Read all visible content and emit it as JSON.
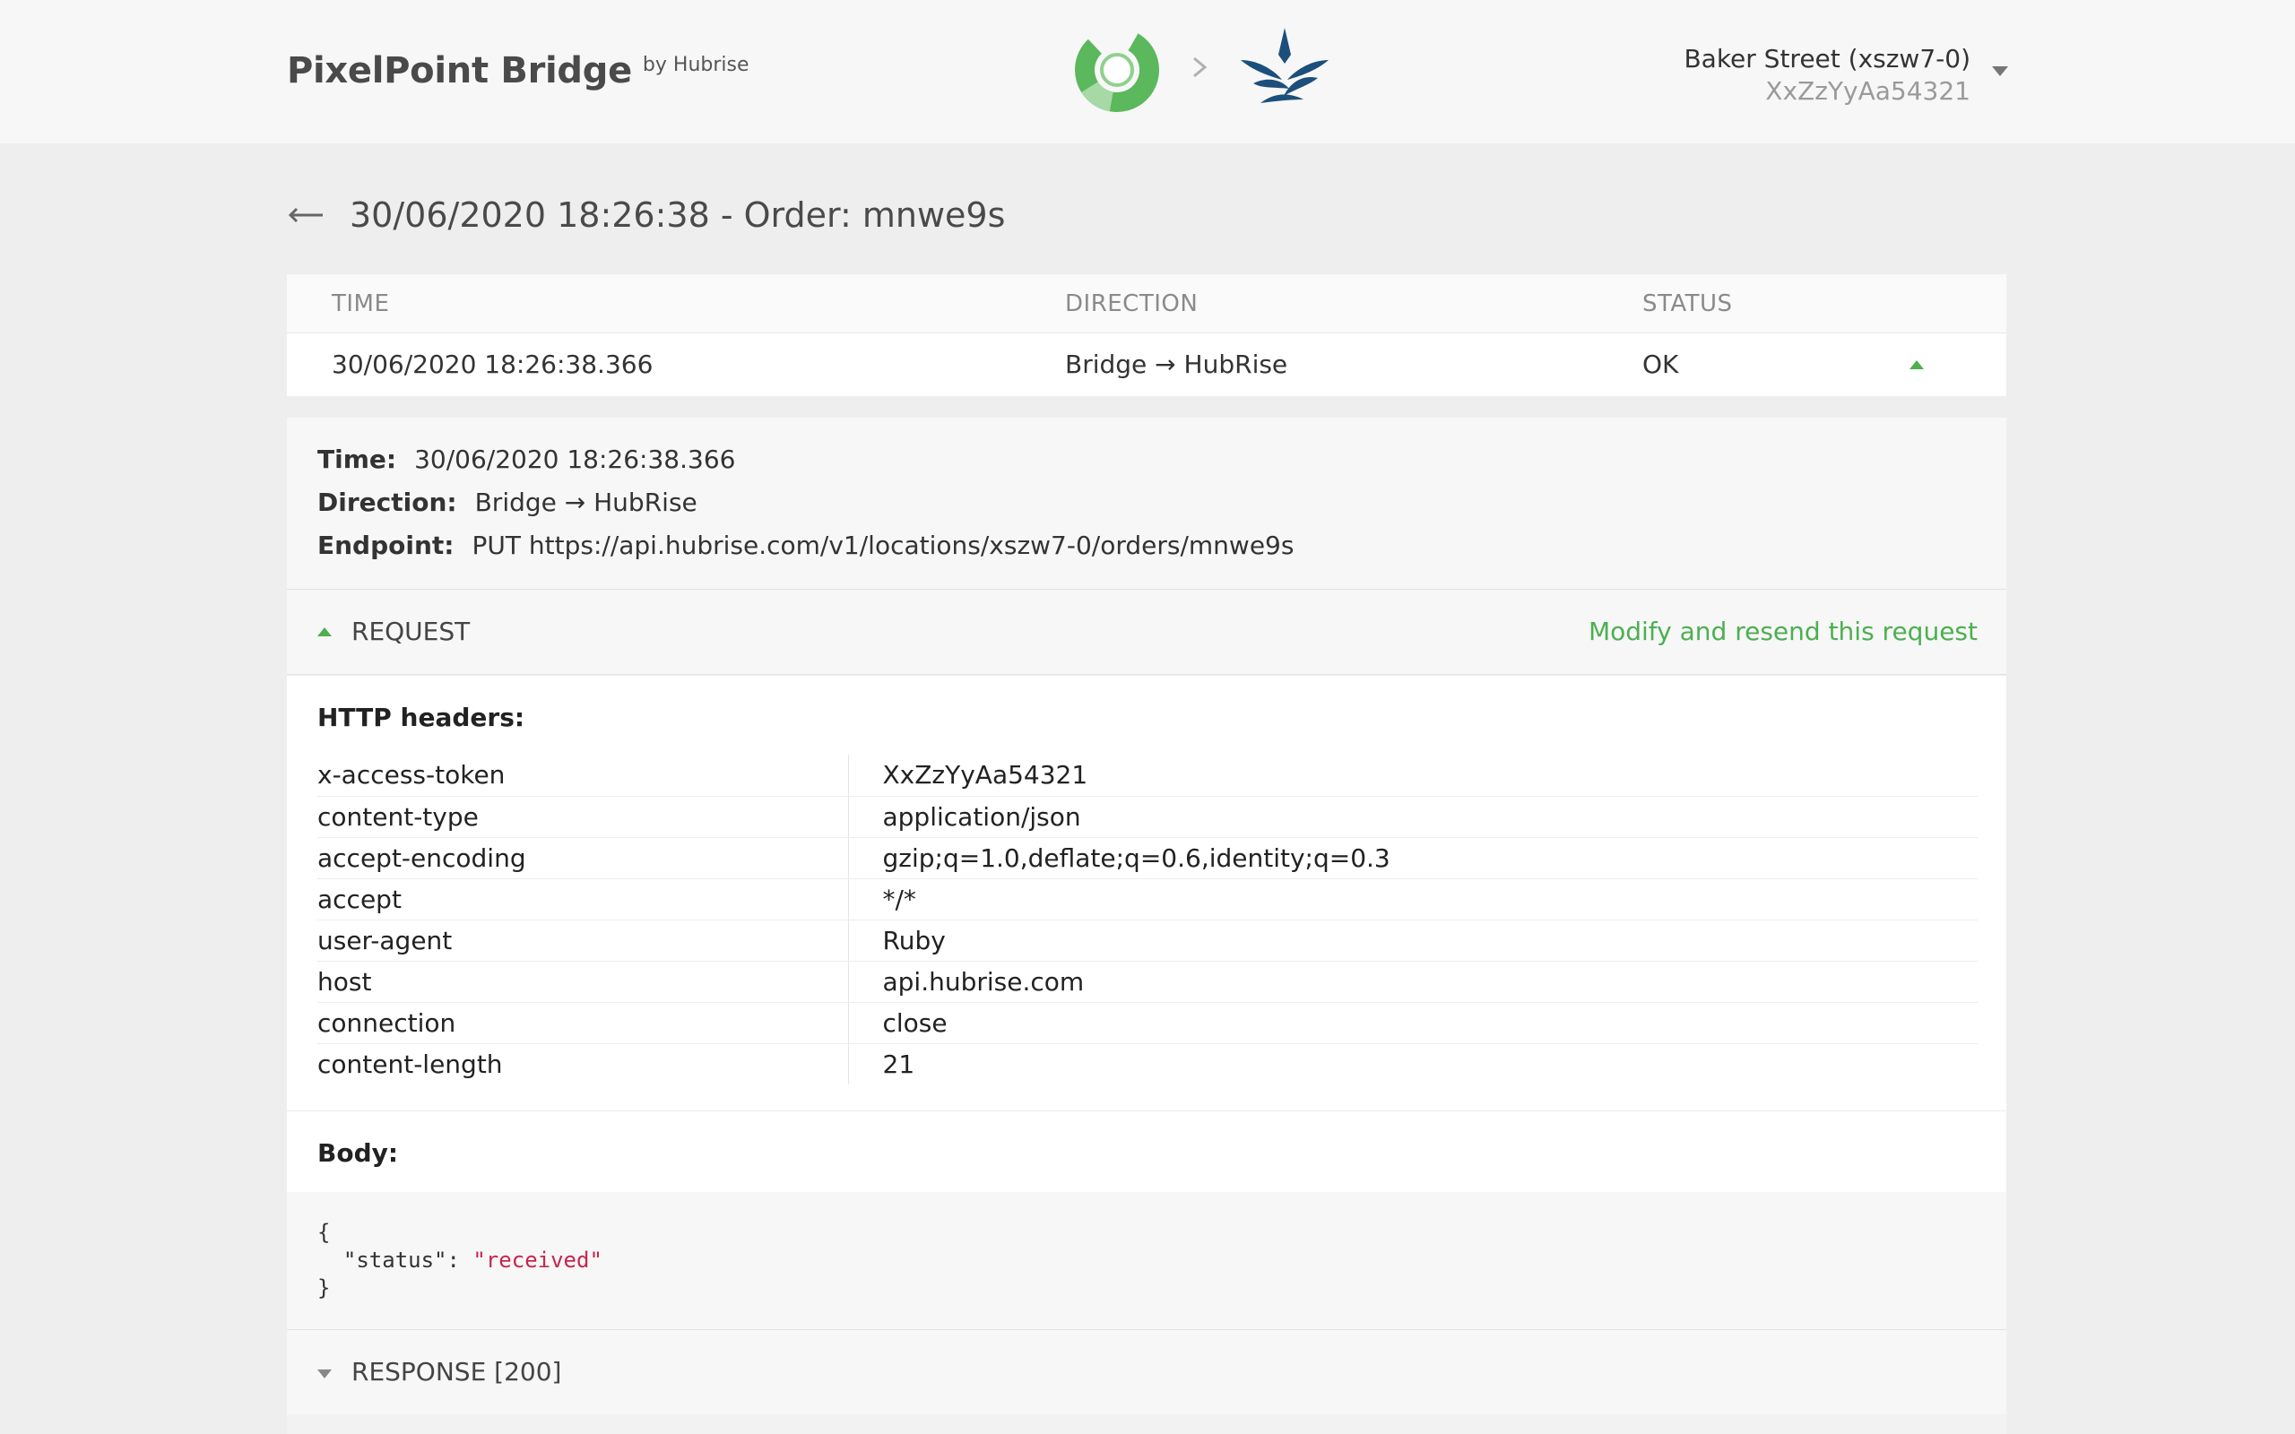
{
  "header": {
    "brand_title": "PixelPoint Bridge",
    "brand_by": "by Hubrise",
    "account_name": "Baker Street (xszw7-0)",
    "account_key": "XxZzYyAa54321"
  },
  "page": {
    "title": "30/06/2020 18:26:38 - Order: mnwe9s"
  },
  "log_table": {
    "columns": [
      "TIME",
      "DIRECTION",
      "STATUS"
    ],
    "row": {
      "time": "30/06/2020 18:26:38.366",
      "direction": "Bridge → HubRise",
      "status": "OK"
    }
  },
  "details": {
    "time_label": "Time:",
    "time_value": "30/06/2020 18:26:38.366",
    "direction_label": "Direction:",
    "direction_value": "Bridge → HubRise",
    "endpoint_label": "Endpoint:",
    "endpoint_value": "PUT https://api.hubrise.com/v1/locations/xszw7-0/orders/mnwe9s"
  },
  "request": {
    "label": "REQUEST",
    "resend_label": "Modify and resend this request",
    "headers_title": "HTTP headers:",
    "headers": [
      {
        "key": "x-access-token",
        "value": "XxZzYyAa54321"
      },
      {
        "key": "content-type",
        "value": "application/json"
      },
      {
        "key": "accept-encoding",
        "value": "gzip;q=1.0,deflate;q=0.6,identity;q=0.3"
      },
      {
        "key": "accept",
        "value": "*/*"
      },
      {
        "key": "user-agent",
        "value": "Ruby"
      },
      {
        "key": "host",
        "value": "api.hubrise.com"
      },
      {
        "key": "connection",
        "value": "close"
      },
      {
        "key": "content-length",
        "value": "21"
      }
    ],
    "body_title": "Body:",
    "body": {
      "open": "{",
      "key": "\"status\"",
      "sep": ": ",
      "value": "\"received\"",
      "close": "}"
    }
  },
  "response": {
    "label": "RESPONSE [200]"
  },
  "colors": {
    "accent": "#4caf50",
    "string": "#c7254e",
    "hubrise_blue": "#1d4f7c"
  },
  "icons": [
    "pixelpoint-logo-icon",
    "chevron-right-icon",
    "hubrise-logo-icon",
    "caret-down-icon",
    "back-arrow-icon",
    "caret-up-icon"
  ]
}
